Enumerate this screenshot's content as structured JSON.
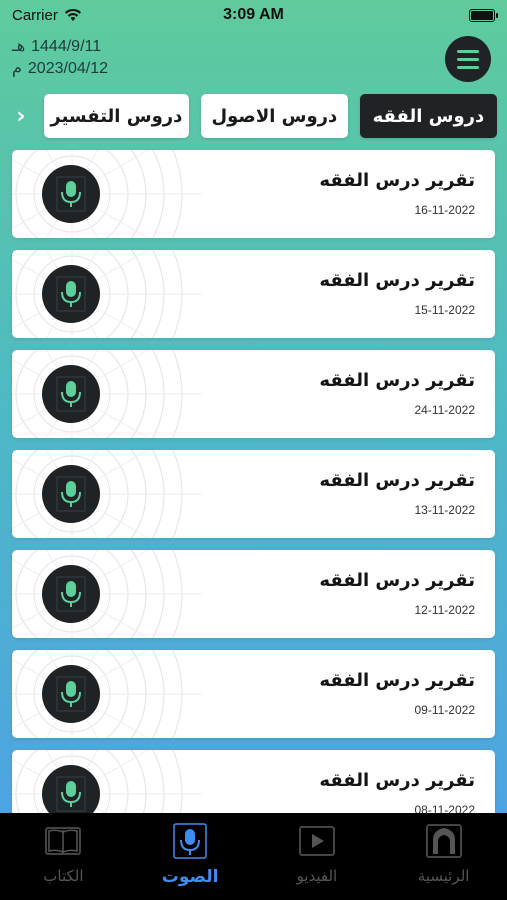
{
  "status_bar": {
    "carrier": "Carrier",
    "time": "3:09 AM"
  },
  "header": {
    "hijri_date": "1444/9/11",
    "hijri_suffix": "هـ",
    "gregorian_date": "2023/04/12",
    "gregorian_suffix": "م"
  },
  "tabs": [
    {
      "label": "دروس الفقه",
      "active": true
    },
    {
      "label": "دروس الاصول",
      "active": false
    },
    {
      "label": "دروس التفسير",
      "active": false
    }
  ],
  "lessons": [
    {
      "title": "تقرير درس الفقه",
      "date": "16-11-2022"
    },
    {
      "title": "تقرير درس الفقه",
      "date": "15-11-2022"
    },
    {
      "title": "تقرير درس الفقه",
      "date": "24-11-2022"
    },
    {
      "title": "تقرير درس الفقه",
      "date": "13-11-2022"
    },
    {
      "title": "تقرير درس الفقه",
      "date": "12-11-2022"
    },
    {
      "title": "تقرير درس الفقه",
      "date": "09-11-2022"
    },
    {
      "title": "تقرير درس الفقه",
      "date": "08-11-2022"
    }
  ],
  "tabbar": [
    {
      "label": "الكتاب",
      "icon": "book-icon",
      "active": false
    },
    {
      "label": "الصوت",
      "icon": "microphone-icon",
      "active": true
    },
    {
      "label": "الفيديو",
      "icon": "video-play-icon",
      "active": false
    },
    {
      "label": "الرئيسية",
      "icon": "mosque-arch-icon",
      "active": false
    }
  ],
  "colors": {
    "accent_green": "#5cd09a",
    "dark": "#1f2326",
    "active_tab_blue": "#3d8ef0"
  }
}
